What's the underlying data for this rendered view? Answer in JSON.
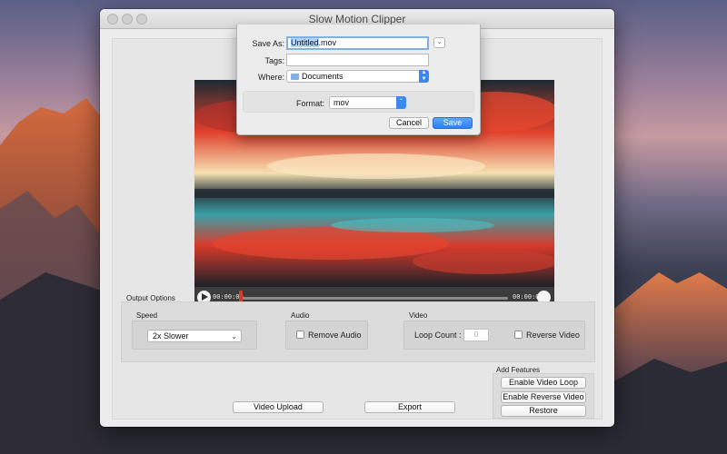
{
  "window": {
    "title": "Slow Motion Clipper"
  },
  "player": {
    "current_time": "00:00:00",
    "end_time": "00:00:05",
    "progress": 0.0
  },
  "output_options": {
    "heading": "Output Options",
    "speed": {
      "label": "Speed",
      "selected": "2x Slower"
    },
    "audio": {
      "label": "Audio",
      "remove_audio_label": "Remove Audio",
      "remove_audio_checked": false
    },
    "video": {
      "label": "Video",
      "loop_count_label": "Loop Count :",
      "loop_count_placeholder": "0",
      "reverse_video_label": "Reverse Video",
      "reverse_video_checked": false
    }
  },
  "add_features": {
    "heading": "Add Features",
    "enable_video_loop": "Enable Video Loop",
    "enable_reverse_video": "Enable Reverse Video",
    "restore": "Restore"
  },
  "actions": {
    "video_upload": "Video Upload",
    "export": "Export"
  },
  "save_dialog": {
    "save_as_label": "Save As:",
    "filename_selected": "Untitled",
    "filename_ext": ".mov",
    "tags_label": "Tags:",
    "tags_value": "",
    "where_label": "Where:",
    "where_value": "Documents",
    "format_label": "Format:",
    "format_value": "mov",
    "cancel": "Cancel",
    "save": "Save"
  },
  "colors": {
    "accent": "#2d7ff3",
    "playhead": "#d63a2a"
  }
}
